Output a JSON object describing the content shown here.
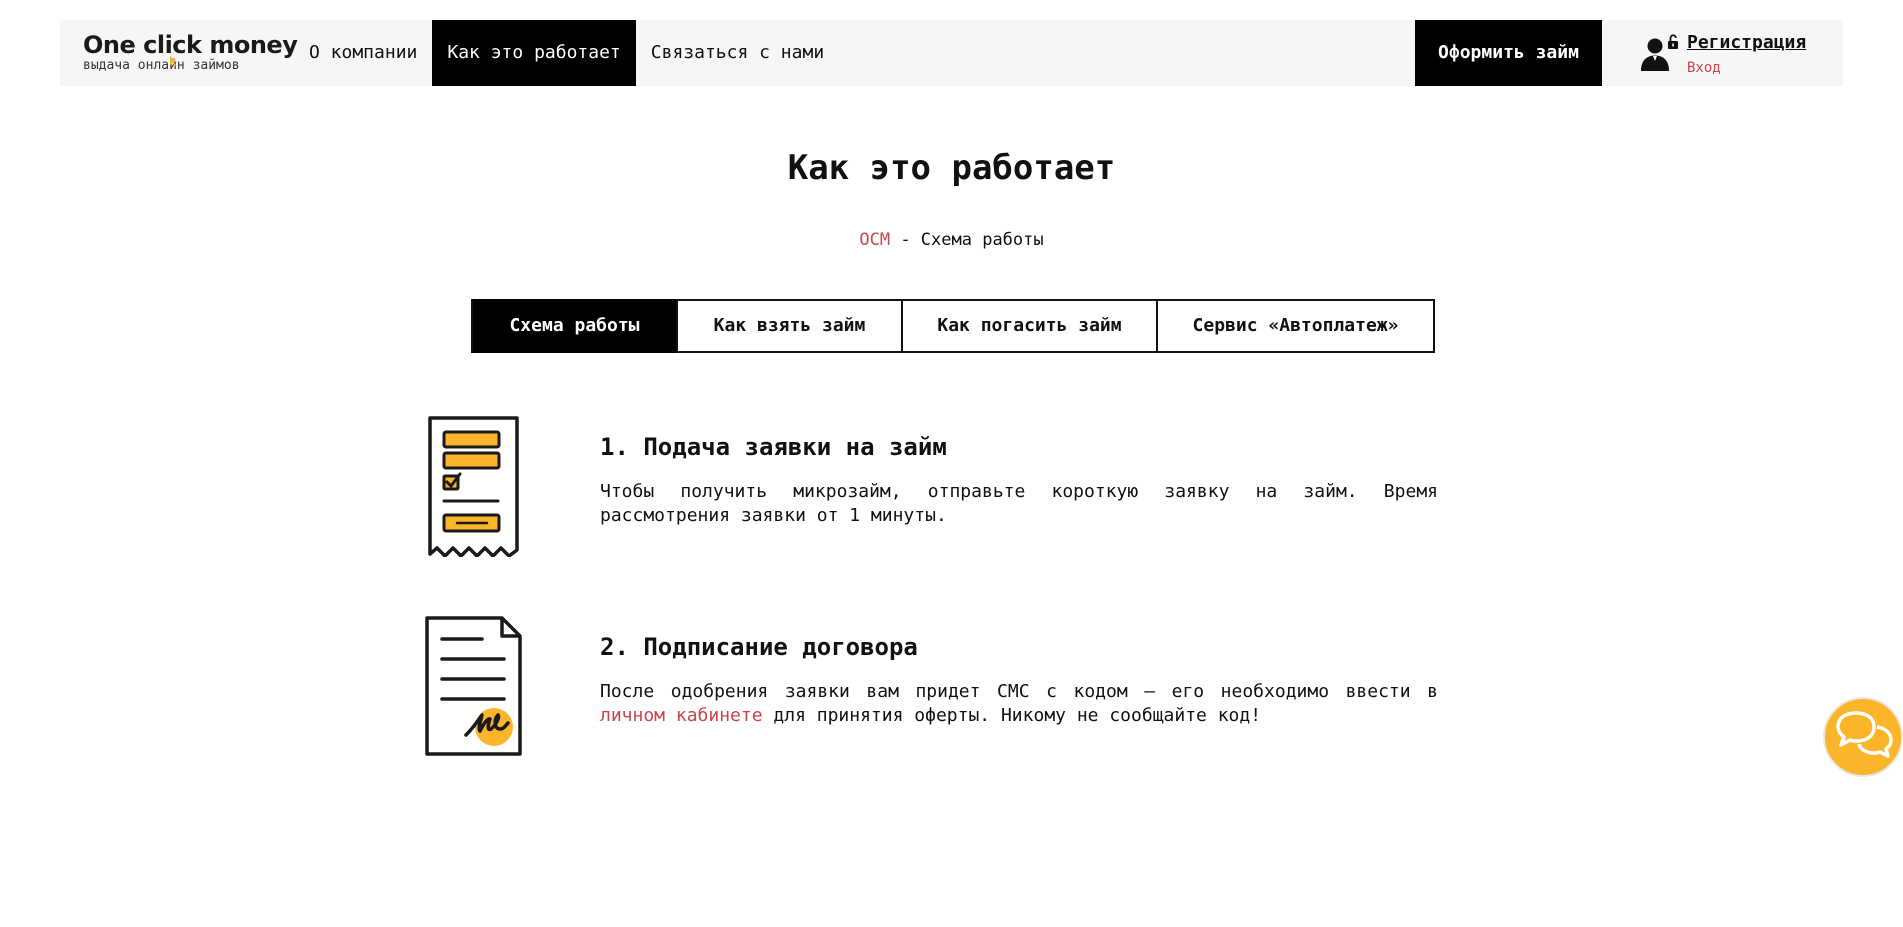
{
  "header": {
    "logo_title": "One click money",
    "logo_subtitle": "выдача онлайн займов",
    "nav": [
      {
        "label": "О компании",
        "active": false
      },
      {
        "label": "Как это работает",
        "active": true
      },
      {
        "label": "Связаться с нами",
        "active": false
      }
    ],
    "cta_label": "Оформить займ",
    "register_label": "Регистрация",
    "login_label": "Вход"
  },
  "main": {
    "title": "Как это работает",
    "breadcrumb": {
      "home": "OCM",
      "separator": " - ",
      "current": "Схема работы"
    },
    "tabs": [
      {
        "label": "Схема работы",
        "active": true
      },
      {
        "label": "Как взять займ",
        "active": false
      },
      {
        "label": "Как погасить займ",
        "active": false
      },
      {
        "label": "Сервис «Автоплатеж»",
        "active": false
      }
    ],
    "steps": [
      {
        "title": "1. Подача заявки на займ",
        "text": "Чтобы получить микрозайм, отправьте короткую заявку на займ. Время рассмотрения заявки от 1 минуты.",
        "icon": "application-form-icon"
      },
      {
        "title": "2. Подписание договора",
        "text_before": "После одобрения заявки вам придет СМС с кодом — его необходимо ввести в ",
        "link": "личном кабинете",
        "text_after": " для принятия оферты. Никому не сообщайте код!",
        "icon": "contract-signature-icon"
      }
    ]
  },
  "colors": {
    "accent_yellow": "#fbb52b",
    "link_red": "#c8454f",
    "header_bg": "#f6f6f6",
    "dark": "#000000"
  }
}
